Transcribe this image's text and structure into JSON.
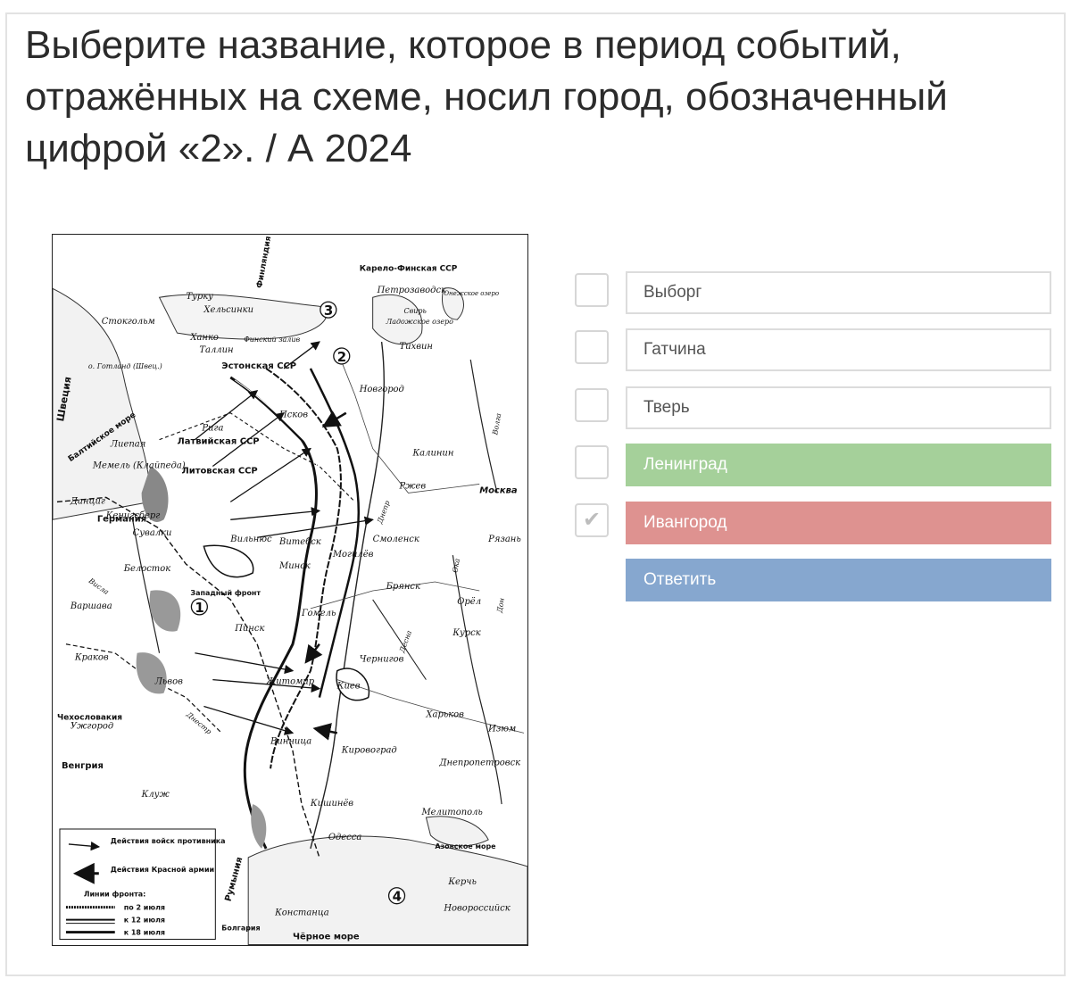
{
  "question": "Выберите название, которое в период событий, отражённых на схеме, носил город, обозначенный цифрой «2». / А 2024",
  "options": [
    {
      "label": "Выборг",
      "checked": false,
      "state": "neutral"
    },
    {
      "label": "Гатчина",
      "checked": false,
      "state": "neutral"
    },
    {
      "label": "Тверь",
      "checked": false,
      "state": "neutral"
    },
    {
      "label": "Ленинград",
      "checked": false,
      "state": "correct"
    },
    {
      "label": "Ивангород",
      "checked": true,
      "state": "wrong"
    }
  ],
  "submit_label": "Ответить",
  "colors": {
    "correct": "#a5d09a",
    "wrong": "#de9290",
    "submit": "#86a7cf"
  },
  "map": {
    "numbers": [
      "1",
      "2",
      "3",
      "4"
    ],
    "cities": [
      "Турку",
      "Хельсинки",
      "Стокгольм",
      "Ханко",
      "Таллин",
      "Рига",
      "Лиепая",
      "Мемель (Клайпеда)",
      "Данциг",
      "Кенигсберг",
      "Сувалки",
      "Белосток",
      "Варшава",
      "Краков",
      "Львов",
      "Ужгород",
      "Клуж",
      "Вильнюс",
      "Витебск",
      "Минск",
      "Смоленск",
      "Могилёв",
      "Брянск",
      "Гомель",
      "Пинск",
      "Житомир",
      "Киев",
      "Чернигов",
      "Винница",
      "Кировоград",
      "Харьков",
      "Изюм",
      "Днепропетровск",
      "Мелитополь",
      "Одесса",
      "Кишинёв",
      "Констанца",
      "Новороссийск",
      "Керчь",
      "Новгород",
      "Псков",
      "Петрозаводск",
      "Тихвин",
      "Калинин",
      "Ржев",
      "Москва",
      "Рязань",
      "Орёл",
      "Курск"
    ],
    "regions": [
      "Эстонская ССР",
      "Латвийская ССР",
      "Литовская ССР",
      "Карело-Финская ССР",
      "Германия",
      "Венгрия",
      "Румыния",
      "Чехословакия",
      "Болгария",
      "Швеция",
      "Финляндия"
    ],
    "water": [
      "Балтийское море",
      "Финский залив",
      "Ладожское озеро",
      "Онежское озеро",
      "Азовское море",
      "Чёрное море"
    ],
    "fronts": [
      "Западный фронт"
    ],
    "islands": [
      "о. Готланд (Швец.)"
    ],
    "rivers": [
      "Днепр",
      "Десна",
      "Ока",
      "Дон",
      "Волга",
      "Висла",
      "Свирь",
      "Днестр"
    ],
    "legend": {
      "enemy": "Действия войск противника",
      "red_army": "Действия Красной армии",
      "fronts_title": "Линии фронта:",
      "l1": "по 2 июля",
      "l2": "к 12 июля",
      "l3": "к 18 июля"
    }
  }
}
